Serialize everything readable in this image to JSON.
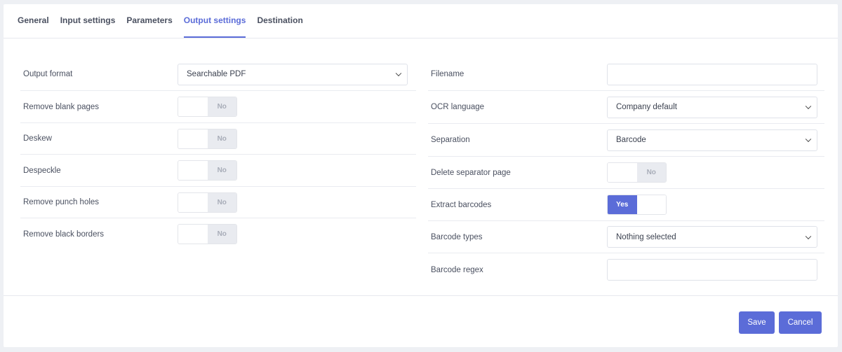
{
  "tabs": [
    {
      "label": "General",
      "active": false
    },
    {
      "label": "Input settings",
      "active": false
    },
    {
      "label": "Parameters",
      "active": false
    },
    {
      "label": "Output settings",
      "active": true
    },
    {
      "label": "Destination",
      "active": false
    }
  ],
  "left": {
    "output_format": {
      "label": "Output format",
      "value": "Searchable PDF"
    },
    "remove_blank_pages": {
      "label": "Remove blank pages",
      "value": "No"
    },
    "deskew": {
      "label": "Deskew",
      "value": "No"
    },
    "despeckle": {
      "label": "Despeckle",
      "value": "No"
    },
    "remove_punch_holes": {
      "label": "Remove punch holes",
      "value": "No"
    },
    "remove_black_borders": {
      "label": "Remove black borders",
      "value": "No"
    }
  },
  "right": {
    "filename": {
      "label": "Filename",
      "value": ""
    },
    "ocr_language": {
      "label": "OCR language",
      "value": "Company default"
    },
    "separation": {
      "label": "Separation",
      "value": "Barcode"
    },
    "delete_separator_page": {
      "label": "Delete separator page",
      "value": "No"
    },
    "extract_barcodes": {
      "label": "Extract barcodes",
      "value": "Yes"
    },
    "barcode_types": {
      "label": "Barcode types",
      "value": "Nothing selected"
    },
    "barcode_regex": {
      "label": "Barcode regex",
      "value": ""
    }
  },
  "footer": {
    "save_label": "Save",
    "cancel_label": "Cancel"
  },
  "colors": {
    "accent": "#5b6cd8",
    "toggle_off": "#e9ebf0"
  }
}
